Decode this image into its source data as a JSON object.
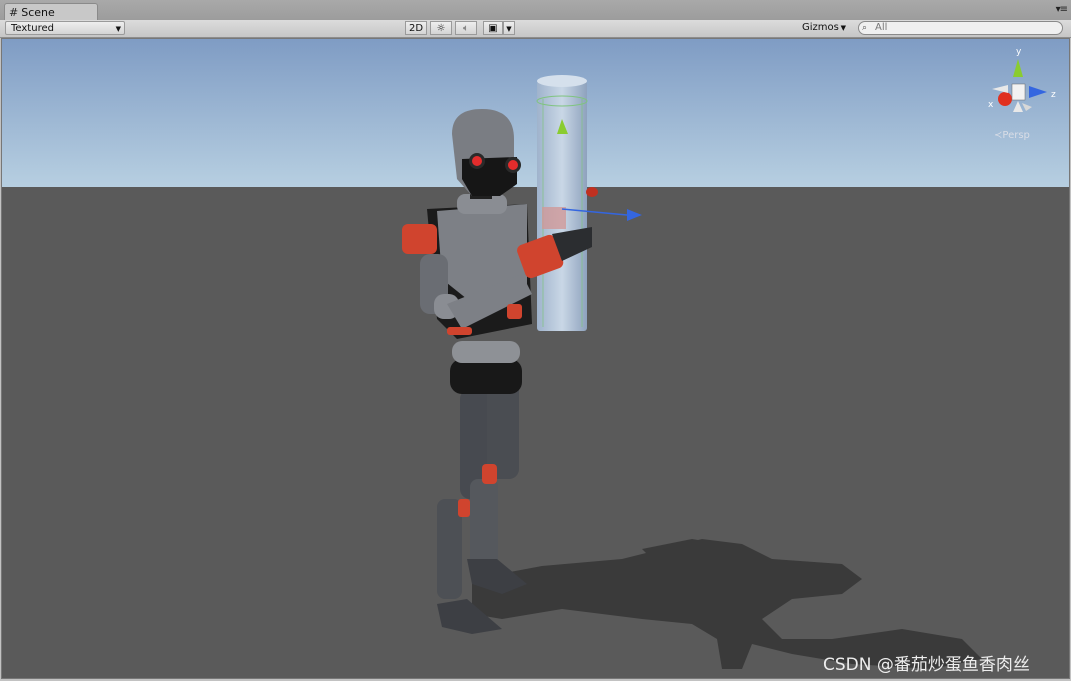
{
  "tab": {
    "icon": "grid-hash-icon",
    "label": "Scene"
  },
  "toolbar": {
    "shading_mode": "Textured",
    "toggle_2d": "2D",
    "lighting_icon": "sun-icon",
    "audio_icon": "speaker-icon",
    "effects_icon": "image-icon",
    "gizmos_label": "Gizmos",
    "search_placeholder": "All"
  },
  "scene_gizmo": {
    "y_label": "y",
    "x_label": "x",
    "z_label": "z",
    "projection_label": "Persp",
    "colors": {
      "x": "#e03020",
      "y": "#8acc30",
      "z": "#3466e0"
    }
  },
  "viewport": {
    "sky_color": "#8ea8c8",
    "ground_color": "#595959"
  },
  "watermark": "CSDN @番茄炒蛋鱼香肉丝"
}
